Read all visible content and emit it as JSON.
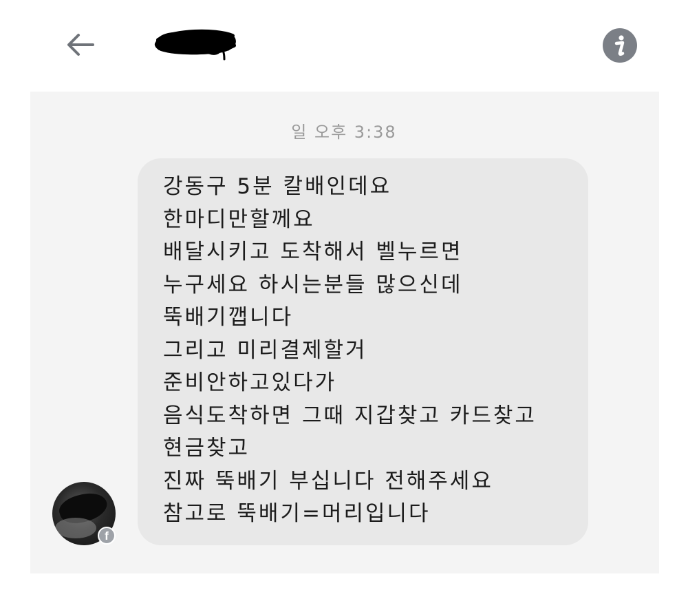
{
  "header": {
    "back_icon": "arrow-left-icon",
    "contact_name": "",
    "info_icon": "info-icon"
  },
  "conversation": {
    "timestamp": "일 오후 3:38",
    "message_lines": [
      "강동구 5분 칼배인데요",
      "한마디만할께요",
      "배달시키고 도착해서 벨누르면",
      "누구세요 하시는분들 많으신데",
      "뚝배기깹니다",
      "그리고 미리결제할거",
      "준비안하고있다가",
      "음식도착하면 그때 지갑찾고 카드찾고",
      "현금찾고",
      "진짜 뚝배기 부십니다 전해주세요",
      "참고로 뚝배기=머리입니다"
    ],
    "sender_badge": "f"
  },
  "colors": {
    "chat_background": "#f4f4f4",
    "bubble_background": "#e8e8e8",
    "timestamp_text": "#9a9a9a",
    "info_button": "#7b7f86",
    "badge": "#9ea2a8"
  }
}
